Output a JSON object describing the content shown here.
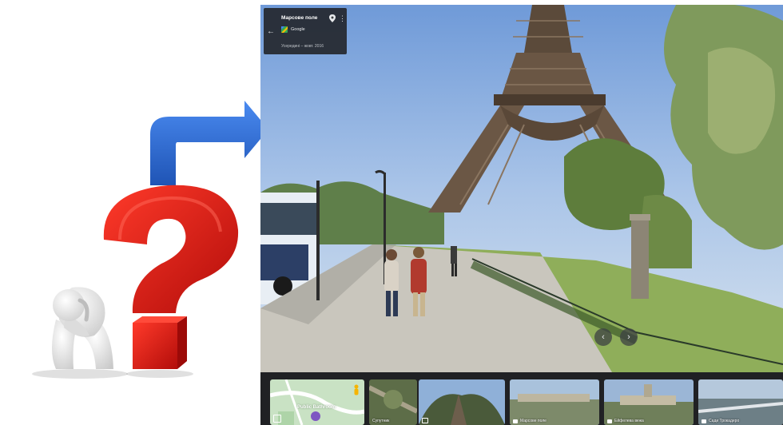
{
  "streetview": {
    "place_title": "Марсове поле",
    "provider": "Google",
    "capture_date": "Усередині – жовт. 2016",
    "back_icon": "arrow-left-icon",
    "pin_icon": "map-pin-icon",
    "more_icon": "more-vert-icon",
    "nav_prev_icon": "chevron-left-icon",
    "nav_next_icon": "chevron-right-icon"
  },
  "minimap": {
    "label": "Public Bathroom",
    "expand_icon": "expand-icon",
    "pegman_icon": "pegman-icon"
  },
  "thumbnails": [
    {
      "label": "Супутник",
      "icon": ""
    },
    {
      "label": "",
      "icon": "photo-icon"
    },
    {
      "label": "Марсове поле",
      "icon": "camera-icon"
    },
    {
      "label": "Ейфелева вежа",
      "icon": "camera-icon"
    },
    {
      "label": "Сади Трокадеро",
      "icon": "camera-icon"
    }
  ],
  "colors": {
    "arrow_blue": "#2f6fd6",
    "question_red": "#d81a14",
    "panel_dark": "#202124"
  }
}
